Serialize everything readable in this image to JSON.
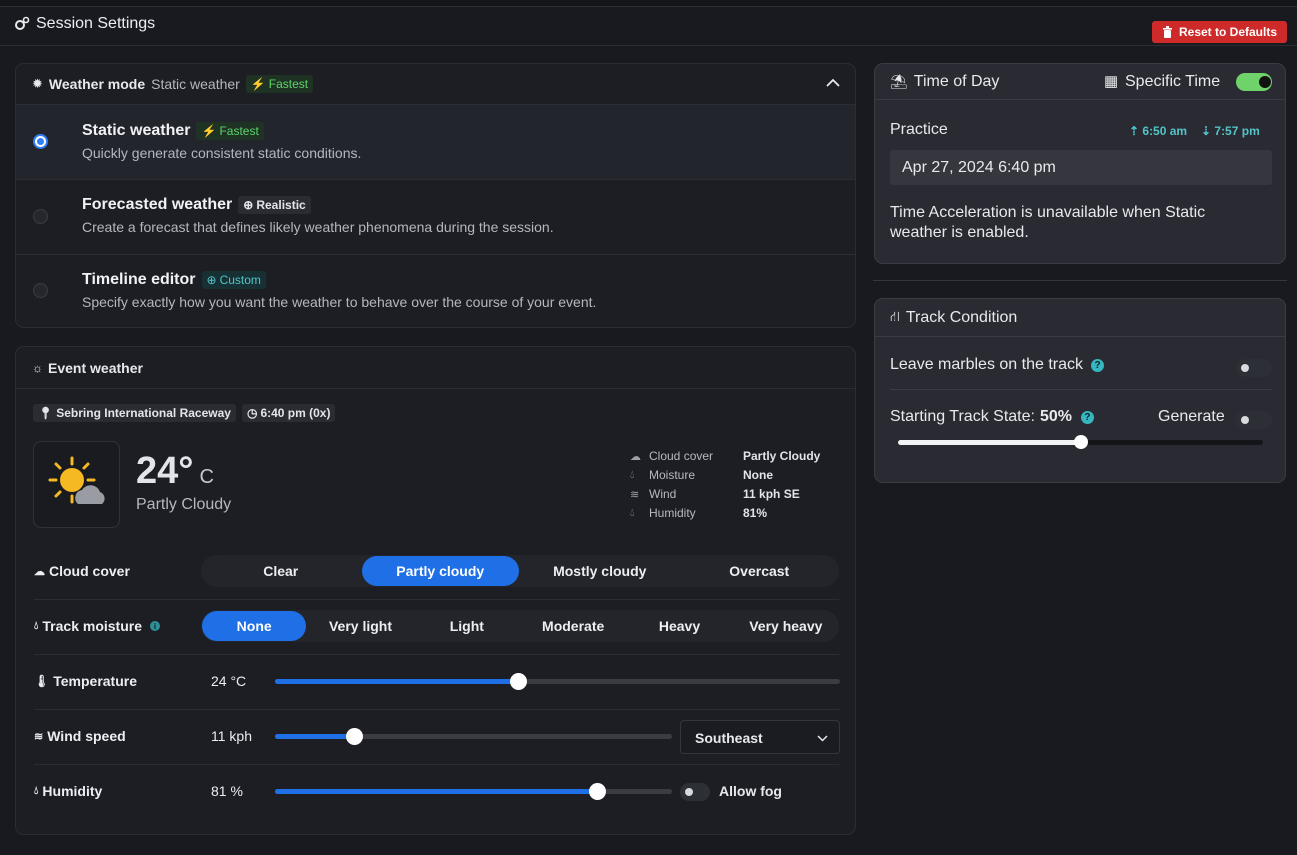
{
  "header": {
    "title": "Session Settings",
    "reset_label": "Reset to Defaults"
  },
  "weather_mode": {
    "title": "Weather mode",
    "current": "Static weather",
    "current_badge": "Fastest",
    "options": [
      {
        "title": "Static weather",
        "badge": "Fastest",
        "desc": "Quickly generate consistent static conditions.",
        "selected": true
      },
      {
        "title": "Forecasted weather",
        "badge": "Realistic",
        "desc": "Create a forecast that defines likely weather phenomena during the session.",
        "selected": false
      },
      {
        "title": "Timeline editor",
        "badge": "Custom",
        "desc": "Specify exactly how you want the weather to behave over the course of your event.",
        "selected": false
      }
    ]
  },
  "event_weather": {
    "title": "Event weather",
    "location": "Sebring International Raceway",
    "time": "6:40 pm (0x)",
    "temp_value": "24°",
    "temp_unit": "C",
    "condition": "Partly Cloudy",
    "stats": [
      {
        "label": "Cloud cover",
        "value": "Partly Cloudy"
      },
      {
        "label": "Moisture",
        "value": "None"
      },
      {
        "label": "Wind",
        "value": "11 kph SE"
      },
      {
        "label": "Humidity",
        "value": "81%"
      }
    ],
    "cloud_cover": {
      "label": "Cloud cover",
      "options": [
        "Clear",
        "Partly cloudy",
        "Mostly cloudy",
        "Overcast"
      ],
      "selected": 1
    },
    "track_moisture": {
      "label": "Track moisture",
      "options": [
        "None",
        "Very light",
        "Light",
        "Moderate",
        "Heavy",
        "Very heavy"
      ],
      "selected": 0
    },
    "temperature": {
      "label": "Temperature",
      "value": "24 °C",
      "fraction": 0.43
    },
    "wind_speed": {
      "label": "Wind speed",
      "value": "11 kph",
      "fraction": 0.2,
      "direction": "Southeast"
    },
    "humidity": {
      "label": "Humidity",
      "value": "81 %",
      "fraction": 0.81,
      "fog_label": "Allow fog",
      "fog_enabled": false
    }
  },
  "time_of_day": {
    "title": "Time of Day",
    "specific_time_label": "Specific Time",
    "specific_time_enabled": true,
    "session": "Practice",
    "sunrise": "6:50 am",
    "sunset": "7:57 pm",
    "datetime": "Apr 27, 2024 6:40 pm",
    "note": "Time Acceleration is unavailable when Static weather is enabled."
  },
  "track_condition": {
    "title": "Track Condition",
    "marbles_label": "Leave marbles on the track",
    "marbles_enabled": false,
    "state_label": "Starting Track State:",
    "state_value": "50%",
    "state_fraction": 0.5,
    "generate_label": "Generate",
    "generate_enabled": false
  },
  "colors": {
    "accent": "#1f6fe6",
    "danger": "#cf2a2a",
    "toggle_on": "#6fd26a",
    "fastest": "#5fd36b",
    "custom": "#52c4c9"
  }
}
